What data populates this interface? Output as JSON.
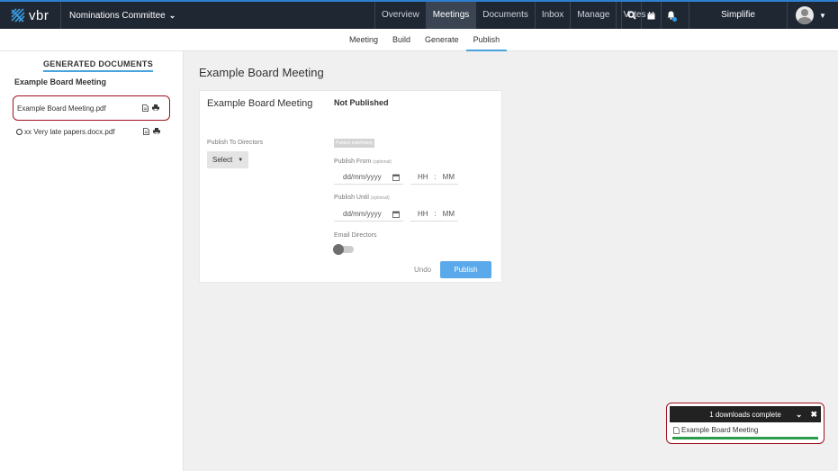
{
  "topbar": {
    "logo_text": "vbr",
    "committee": "Nominations Committee",
    "nav": [
      "Overview",
      "Meetings",
      "Documents",
      "Inbox",
      "Manage",
      "Votes"
    ],
    "active_nav": "Meetings",
    "icons": [
      "search-icon",
      "calendar-icon",
      "bell-icon"
    ],
    "brand": "Simplifie"
  },
  "subnav": {
    "tabs": [
      "Meeting",
      "Build",
      "Generate",
      "Publish"
    ],
    "active": "Publish"
  },
  "sidebar": {
    "heading": "GENERATED DOCUMENTS",
    "meeting": "Example Board Meeting",
    "docs": [
      {
        "name": "Example Board Meeting.pdf",
        "late": false
      },
      {
        "name": "xx Very late papers.docx.pdf",
        "late": true
      }
    ]
  },
  "main": {
    "title": "Example Board Meeting",
    "card": {
      "title": "Example Board Meeting",
      "status": "Not Published",
      "publish_to_label": "Publish To Directors",
      "select_label": "Select",
      "indefinitely": "Publish indefinitely",
      "from_label": "Publish From",
      "until_label": "Publish Until",
      "optional": "(optional)",
      "date_placeholder": "dd/mm/yyyy",
      "hh": "HH",
      "mm": "MM",
      "sep": ":",
      "email_label": "Email Directors",
      "email_on": false,
      "undo": "Undo",
      "publish": "Publish"
    }
  },
  "toast": {
    "title": "1 downloads complete",
    "item": "Example Board Meeting",
    "progress": 1.0,
    "progress_color": "#2a9d4a"
  },
  "colors": {
    "topbar": "#1f2733",
    "accent": "#4aa3df",
    "publish_button": "#5aa9ea",
    "highlight_border": "#a01020"
  }
}
